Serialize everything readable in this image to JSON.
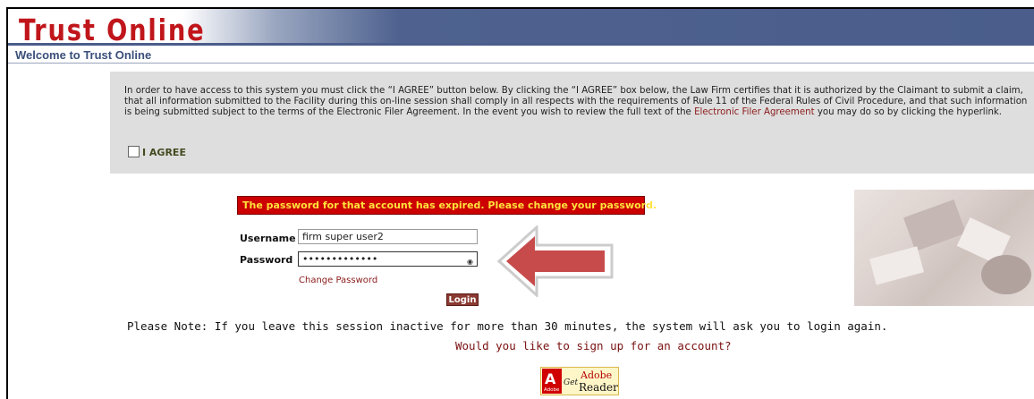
{
  "header": {
    "logo": "Trust Online"
  },
  "page": {
    "welcome": "Welcome to Trust Online"
  },
  "agreement": {
    "text_before": "In order to have access to this system you must click the “I AGREE” button below. By clicking the “I AGREE” box below, the Law Firm certifies that it is authorized by the Claimant to submit a claim, that all information submitted to the Facility during this on-line session shall comply in all respects with the requirements of Rule 11 of the Federal Rules of Civil Procedure, and that such information is being submitted subject to the terms of the Electronic Filer Agreement. In the event you wish to review the full text of the ",
    "link": "Electronic Filer Agreement",
    "text_after": " you may do so by clicking the hyperlink.",
    "checkbox_label": "I AGREE"
  },
  "login": {
    "error": "The password for that account has expired. Please change your password.",
    "username_label": "Username",
    "username_value": "firm super user2",
    "password_label": "Password",
    "password_value": "•••••••••••••",
    "change_password": "Change Password",
    "login_button": "Login"
  },
  "footer": {
    "note": "Please Note: If you leave this session inactive for more than 30 minutes, the system will ask you to login again.",
    "signup": "Would you like to sign up for an account?"
  },
  "adobe": {
    "mark": "A",
    "small": "Adobe",
    "get": "Get",
    "brand": "Adobe",
    "product": "Reader"
  }
}
